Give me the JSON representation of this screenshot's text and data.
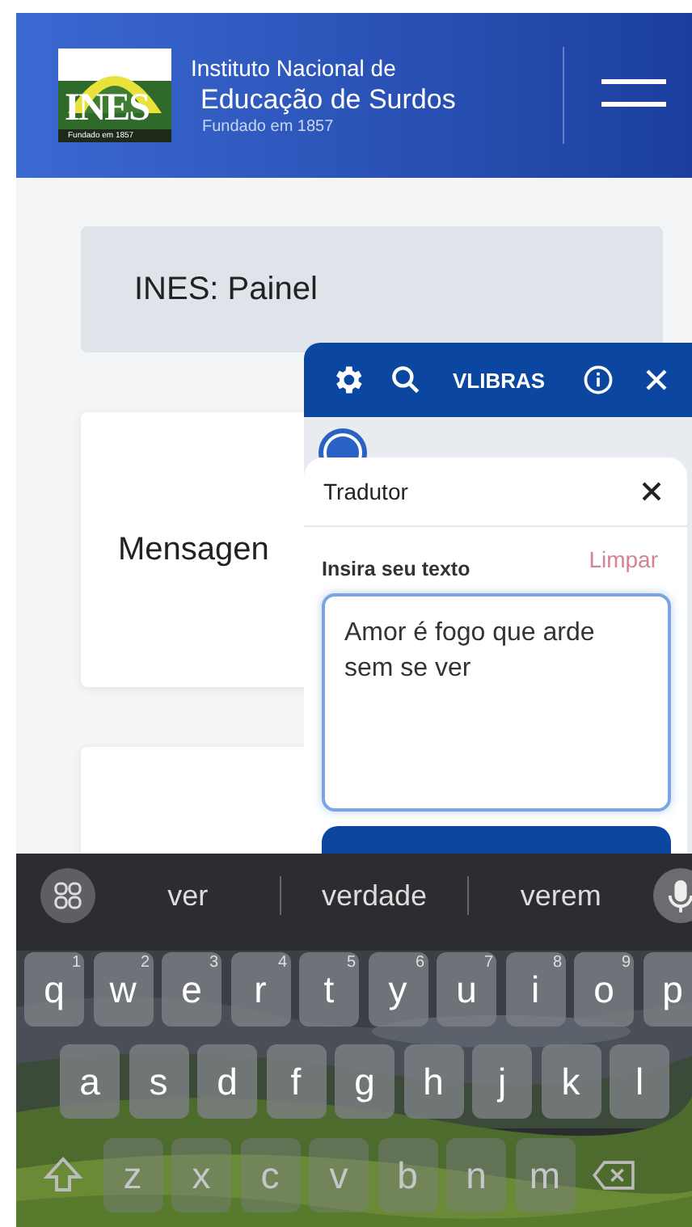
{
  "header": {
    "logo_text": "INES",
    "logo_caption": "Fundado em 1857",
    "title_line1": "Instituto Nacional de",
    "title_line2": "Educação de Surdos",
    "subtitle": "Fundado em 1857"
  },
  "cards": [
    {
      "kind": "panel",
      "title": "INES: Painel"
    },
    {
      "kind": "message",
      "title": "Mensagen"
    },
    {
      "kind": "blank"
    }
  ],
  "vlibras": {
    "brand": "VLIBRAS",
    "translator": {
      "title": "Tradutor",
      "input_label": "Insira seu texto",
      "clear": "Limpar",
      "value": "Amor é fogo que arde sem se ver"
    }
  },
  "keyboard": {
    "suggestions": [
      "ver",
      "verdade",
      "verem"
    ],
    "rows": [
      [
        {
          "key": "q",
          "hint": "1"
        },
        {
          "key": "w",
          "hint": "2"
        },
        {
          "key": "e",
          "hint": "3"
        },
        {
          "key": "r",
          "hint": "4"
        },
        {
          "key": "t",
          "hint": "5"
        },
        {
          "key": "y",
          "hint": "6"
        },
        {
          "key": "u",
          "hint": "7"
        },
        {
          "key": "i",
          "hint": "8"
        },
        {
          "key": "o",
          "hint": "9"
        },
        {
          "key": "p"
        }
      ],
      [
        {
          "key": "a"
        },
        {
          "key": "s"
        },
        {
          "key": "d"
        },
        {
          "key": "f"
        },
        {
          "key": "g"
        },
        {
          "key": "h"
        },
        {
          "key": "j"
        },
        {
          "key": "k"
        },
        {
          "key": "l"
        }
      ],
      [
        {
          "key": "z"
        },
        {
          "key": "x"
        },
        {
          "key": "c"
        },
        {
          "key": "v"
        },
        {
          "key": "b"
        },
        {
          "key": "n"
        },
        {
          "key": "m"
        }
      ]
    ]
  }
}
